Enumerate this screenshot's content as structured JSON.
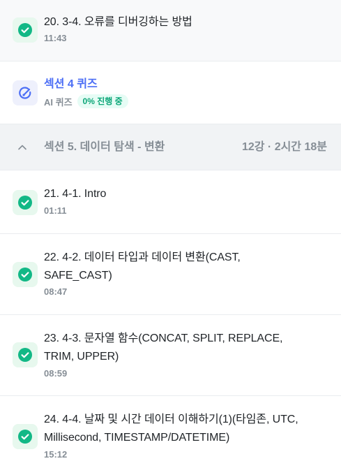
{
  "lessons_top": {
    "title": "20. 3-4. 오류를 디버깅하는 방법",
    "time": "11:43"
  },
  "quiz": {
    "title": "섹션 4 퀴즈",
    "sub": "AI 퀴즈",
    "badge": "0% 진행 중"
  },
  "section": {
    "title": "섹션 5. 데이터 탐색 - 변환",
    "meta": "12강 · 2시간 18분"
  },
  "lessons": [
    {
      "title": "21. 4-1. Intro",
      "time": "01:11"
    },
    {
      "title": "22. 4-2. 데이터 타입과 데이터 변환(CAST, SAFE_CAST)",
      "time": "08:47"
    },
    {
      "title": "23. 4-3. 문자열 함수(CONCAT, SPLIT, REPLACE, TRIM, UPPER)",
      "time": "08:59"
    },
    {
      "title": "24. 4-4. 날짜 및 시간 데이터 이해하기(1)(타임존, UTC, Millisecond, TIMESTAMP/DATETIME)",
      "time": "15:12"
    }
  ],
  "colors": {
    "check": "#12b886",
    "quiz_accent": "#4c6ef5",
    "badge_text": "#0ca678"
  },
  "icons": {
    "completed": "check-circle-icon",
    "quiz": "quiz-icon",
    "collapse": "chevron-up-icon"
  }
}
